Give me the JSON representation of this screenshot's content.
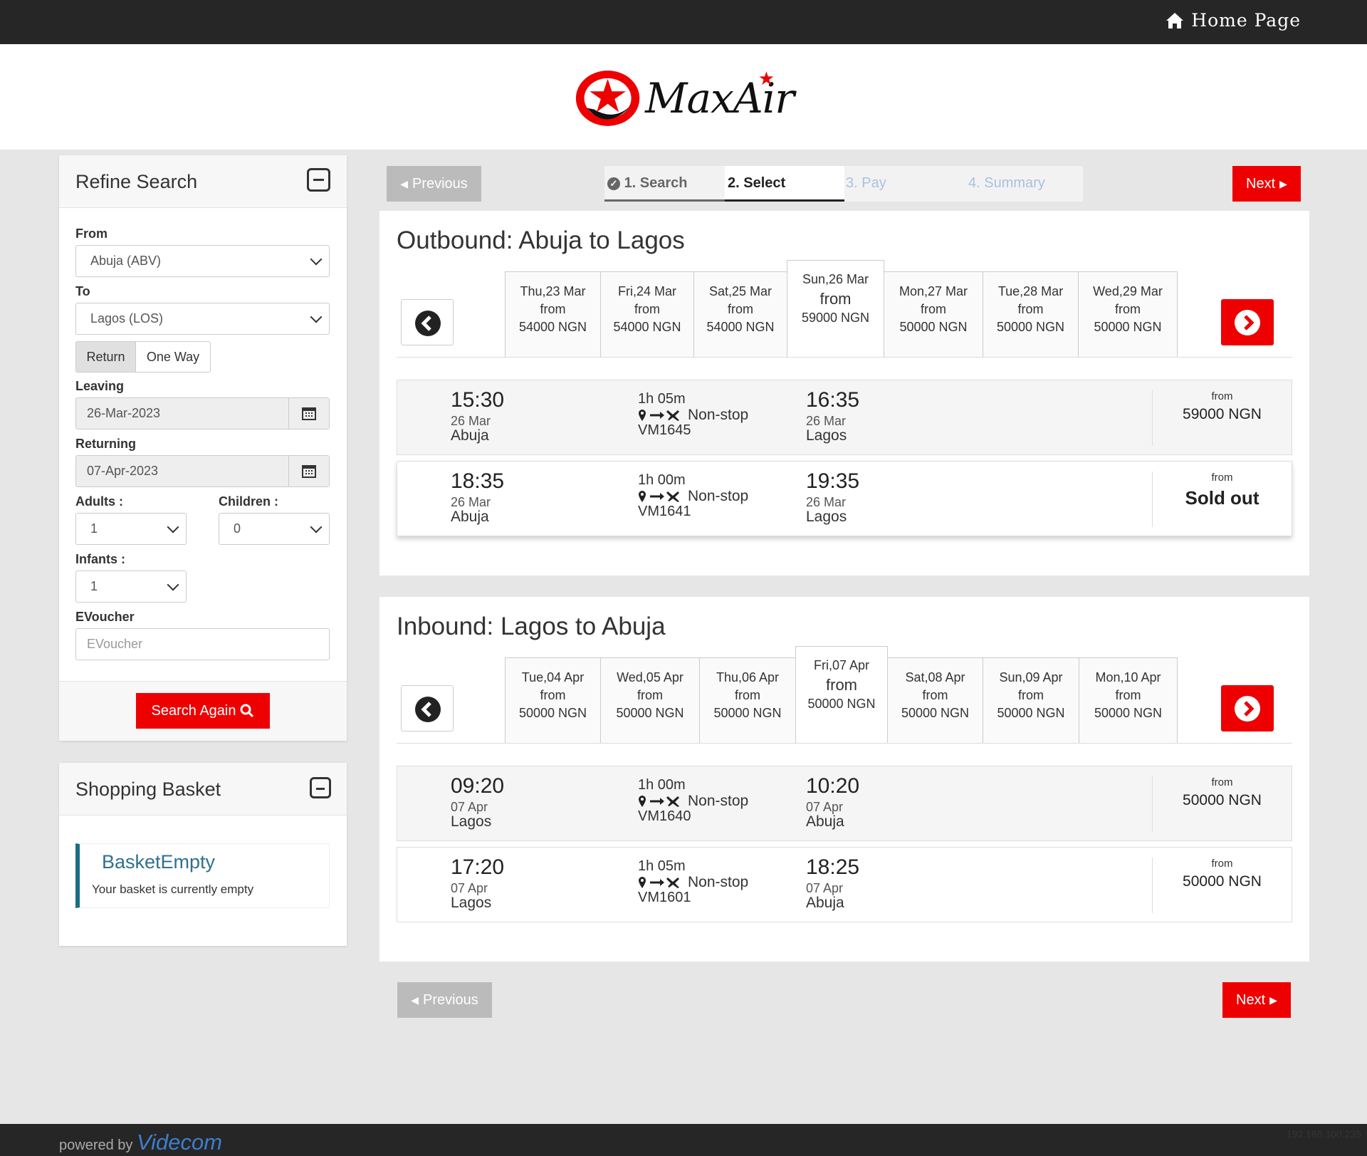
{
  "header": {
    "home_label": "Home Page"
  },
  "logo": {
    "text": "MaxAir"
  },
  "refine": {
    "title": "Refine Search",
    "from_label": "From",
    "from_value": "Abuja (ABV)",
    "to_label": "To",
    "to_value": "Lagos (LOS)",
    "trip_types": [
      "Return",
      "One Way"
    ],
    "selected_trip_type": "Return",
    "leaving_label": "Leaving",
    "leaving_value": "26-Mar-2023",
    "returning_label": "Returning",
    "returning_value": "07-Apr-2023",
    "adults_label": "Adults",
    "adults_value": "1",
    "children_label": "Children",
    "children_value": "0",
    "infants_label": "Infants",
    "infants_value": "1",
    "evoucher_label": "EVoucher",
    "evoucher_placeholder": "EVoucher",
    "search_again_label": "Search Again"
  },
  "basket": {
    "title": "Shopping Basket",
    "empty_title": "BasketEmpty",
    "empty_text": "Your basket is currently empty"
  },
  "steps": {
    "previous_label": "Previous",
    "next_label": "Next",
    "items": [
      {
        "label": "1. Search",
        "state": "done"
      },
      {
        "label": "2. Select",
        "state": "active"
      },
      {
        "label": "3. Pay",
        "state": "todo"
      },
      {
        "label": "4. Summary",
        "state": "todo"
      }
    ]
  },
  "outbound": {
    "title": "Outbound: Abuja to Lagos",
    "dates": [
      {
        "day": "Thu,23 Mar",
        "from": "from",
        "price": "54000 NGN"
      },
      {
        "day": "Fri,24 Mar",
        "from": "from",
        "price": "54000 NGN"
      },
      {
        "day": "Sat,25 Mar",
        "from": "from",
        "price": "54000 NGN"
      },
      {
        "day": "Sun,26 Mar",
        "from": "from",
        "price": "59000 NGN"
      },
      {
        "day": "Mon,27 Mar",
        "from": "from",
        "price": "50000 NGN"
      },
      {
        "day": "Tue,28 Mar",
        "from": "from",
        "price": "50000 NGN"
      },
      {
        "day": "Wed,29 Mar",
        "from": "from",
        "price": "50000 NGN"
      }
    ],
    "selected_index": 3,
    "flights": [
      {
        "dep_time": "15:30",
        "dep_date": "26 Mar",
        "dep_city": "Abuja",
        "duration": "1h 05m",
        "stops": "Non-stop",
        "flight_no": "VM1645",
        "arr_time": "16:35",
        "arr_date": "26 Mar",
        "arr_city": "Lagos",
        "price_from": "from",
        "price": "59000 NGN"
      },
      {
        "dep_time": "18:35",
        "dep_date": "26 Mar",
        "dep_city": "Abuja",
        "duration": "1h 00m",
        "stops": "Non-stop",
        "flight_no": "VM1641",
        "arr_time": "19:35",
        "arr_date": "26 Mar",
        "arr_city": "Lagos",
        "price_from": "from",
        "price": "Sold out"
      }
    ]
  },
  "inbound": {
    "title": "Inbound: Lagos to Abuja",
    "dates": [
      {
        "day": "Tue,04 Apr",
        "from": "from",
        "price": "50000 NGN"
      },
      {
        "day": "Wed,05 Apr",
        "from": "from",
        "price": "50000 NGN"
      },
      {
        "day": "Thu,06 Apr",
        "from": "from",
        "price": "50000 NGN"
      },
      {
        "day": "Fri,07 Apr",
        "from": "from",
        "price": "50000 NGN"
      },
      {
        "day": "Sat,08 Apr",
        "from": "from",
        "price": "50000 NGN"
      },
      {
        "day": "Sun,09 Apr",
        "from": "from",
        "price": "50000 NGN"
      },
      {
        "day": "Mon,10 Apr",
        "from": "from",
        "price": "50000 NGN"
      }
    ],
    "selected_index": 3,
    "flights": [
      {
        "dep_time": "09:20",
        "dep_date": "07 Apr",
        "dep_city": "Lagos",
        "duration": "1h 00m",
        "stops": "Non-stop",
        "flight_no": "VM1640",
        "arr_time": "10:20",
        "arr_date": "07 Apr",
        "arr_city": "Abuja",
        "price_from": "from",
        "price": "50000 NGN"
      },
      {
        "dep_time": "17:20",
        "dep_date": "07 Apr",
        "dep_city": "Lagos",
        "duration": "1h 05m",
        "stops": "Non-stop",
        "flight_no": "VM1601",
        "arr_time": "18:25",
        "arr_date": "07 Apr",
        "arr_city": "Abuja",
        "price_from": "from",
        "price": "50000 NGN"
      }
    ]
  },
  "footer": {
    "powered_by": "powered by",
    "brand": "Videcom",
    "ip": "192.168.100.235"
  },
  "colors": {
    "accent": "#ee0000",
    "topbar": "#262626",
    "basket_accent": "#1b6d85"
  }
}
